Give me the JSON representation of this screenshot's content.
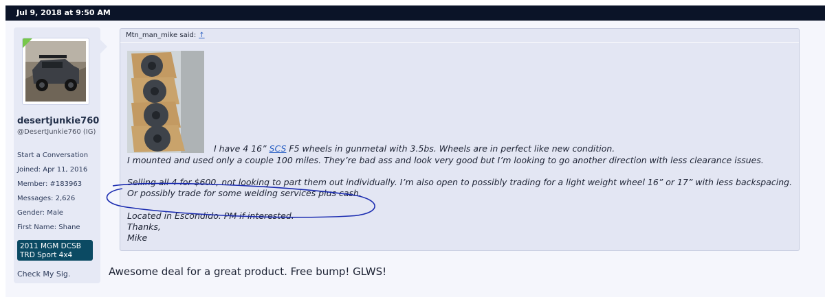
{
  "post": {
    "date": "Jul 9, 2018 at 9:50 AM",
    "user": {
      "name": "desertjunkie760",
      "title": "@DesertJunkie760 (IG)",
      "start_conversation": "Start a Conversation",
      "joined": "Joined: Apr 11, 2016",
      "member": "Member: #183963",
      "messages": "Messages: 2,626",
      "gender": "Gender: Male",
      "first_name": "First Name: Shane",
      "badge_line1": "2011 MGM DCSB",
      "badge_line2": "TRD Sport 4x4",
      "check_sig": "Check My Sig."
    },
    "quote": {
      "author_said": "Mtn_man_mike said:",
      "up_arrow": "↑",
      "line1_pre": "I have 4 16” ",
      "line1_link": "SCS",
      "line1_post": " F5 wheels in gunmetal with 3.5bs. Wheels are in perfect like new condition.",
      "line2": "I mounted and used only a couple 100 miles. They’re bad ass and look very good but I’m looking to go another direction with less clearance issues.",
      "para2": "Selling all 4 for $600, not looking to part them out individually. I’m also open to possibly trading for a light weight wheel 16” or 17” with less backspacing. Or possibly trade for some welding services plus cash.",
      "location": "Located in Escondido. PM if interested.",
      "thanks": "Thanks,",
      "signoff": "Mike"
    },
    "reply": "Awesome deal for a great product. Free bump! GLWS!"
  },
  "colors": {
    "topbar": "#0b1428",
    "quote_bg": "#e3e6f3",
    "link": "#2d62c4",
    "badge": "#0b4a63",
    "annotation": "#1a2bb0"
  }
}
